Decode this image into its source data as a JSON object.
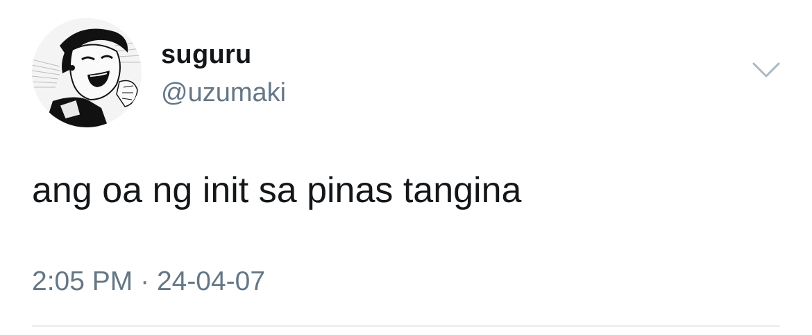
{
  "user": {
    "display_name": "suguru",
    "handle": "@uzumaki",
    "avatar_icon": "manga-character-avatar"
  },
  "tweet": {
    "text": "ang oa ng init sa pinas tangina",
    "time": "2:05 PM",
    "separator": "·",
    "date": "24-04-07"
  },
  "menu": {
    "icon": "chevron-down-icon"
  },
  "colors": {
    "text": "#14171a",
    "secondary_text": "#657786",
    "divider": "#e6ecf0",
    "chevron": "#aab8c2"
  }
}
